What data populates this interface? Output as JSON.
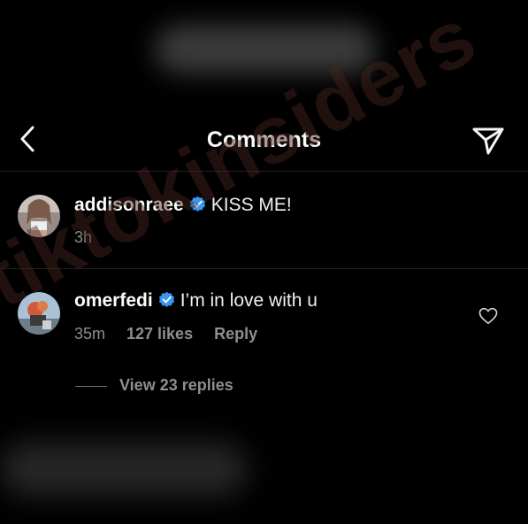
{
  "header": {
    "title": "Comments",
    "back_icon": "chevron-left-icon",
    "send_icon": "paper-plane-icon"
  },
  "comments": [
    {
      "username": "addisonraee",
      "verified": true,
      "text": "KISS ME!",
      "time": "3h"
    },
    {
      "username": "omerfedi",
      "verified": true,
      "text": "I’m in love with u",
      "time": "35m",
      "likes": "127 likes",
      "reply_label": "Reply",
      "view_replies": "View 23 replies"
    }
  ],
  "watermark": "tiktokinsiders",
  "colors": {
    "background": "#000000",
    "verified_badge": "#3897f0",
    "muted_text": "#8e8e8e"
  }
}
